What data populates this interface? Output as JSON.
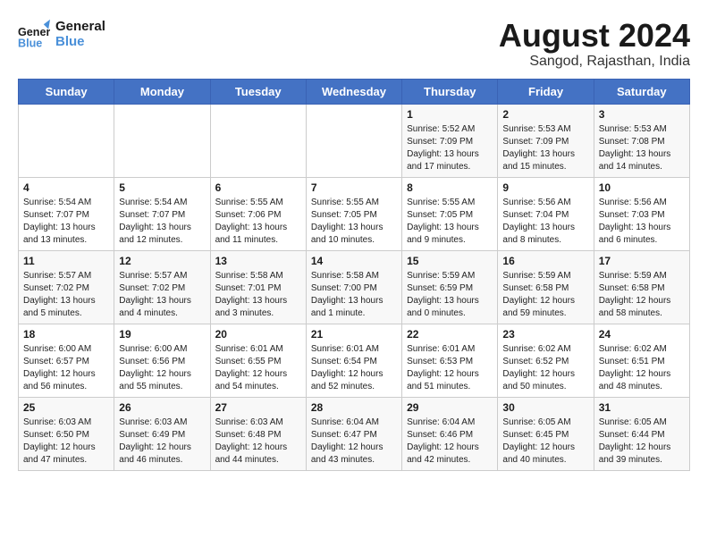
{
  "header": {
    "logo_line1": "General",
    "logo_line2": "Blue",
    "title": "August 2024",
    "subtitle": "Sangod, Rajasthan, India"
  },
  "calendar": {
    "weekdays": [
      "Sunday",
      "Monday",
      "Tuesday",
      "Wednesday",
      "Thursday",
      "Friday",
      "Saturday"
    ],
    "weeks": [
      [
        {
          "date": "",
          "info": ""
        },
        {
          "date": "",
          "info": ""
        },
        {
          "date": "",
          "info": ""
        },
        {
          "date": "",
          "info": ""
        },
        {
          "date": "1",
          "info": "Sunrise: 5:52 AM\nSunset: 7:09 PM\nDaylight: 13 hours and 17 minutes."
        },
        {
          "date": "2",
          "info": "Sunrise: 5:53 AM\nSunset: 7:09 PM\nDaylight: 13 hours and 15 minutes."
        },
        {
          "date": "3",
          "info": "Sunrise: 5:53 AM\nSunset: 7:08 PM\nDaylight: 13 hours and 14 minutes."
        }
      ],
      [
        {
          "date": "4",
          "info": "Sunrise: 5:54 AM\nSunset: 7:07 PM\nDaylight: 13 hours and 13 minutes."
        },
        {
          "date": "5",
          "info": "Sunrise: 5:54 AM\nSunset: 7:07 PM\nDaylight: 13 hours and 12 minutes."
        },
        {
          "date": "6",
          "info": "Sunrise: 5:55 AM\nSunset: 7:06 PM\nDaylight: 13 hours and 11 minutes."
        },
        {
          "date": "7",
          "info": "Sunrise: 5:55 AM\nSunset: 7:05 PM\nDaylight: 13 hours and 10 minutes."
        },
        {
          "date": "8",
          "info": "Sunrise: 5:55 AM\nSunset: 7:05 PM\nDaylight: 13 hours and 9 minutes."
        },
        {
          "date": "9",
          "info": "Sunrise: 5:56 AM\nSunset: 7:04 PM\nDaylight: 13 hours and 8 minutes."
        },
        {
          "date": "10",
          "info": "Sunrise: 5:56 AM\nSunset: 7:03 PM\nDaylight: 13 hours and 6 minutes."
        }
      ],
      [
        {
          "date": "11",
          "info": "Sunrise: 5:57 AM\nSunset: 7:02 PM\nDaylight: 13 hours and 5 minutes."
        },
        {
          "date": "12",
          "info": "Sunrise: 5:57 AM\nSunset: 7:02 PM\nDaylight: 13 hours and 4 minutes."
        },
        {
          "date": "13",
          "info": "Sunrise: 5:58 AM\nSunset: 7:01 PM\nDaylight: 13 hours and 3 minutes."
        },
        {
          "date": "14",
          "info": "Sunrise: 5:58 AM\nSunset: 7:00 PM\nDaylight: 13 hours and 1 minute."
        },
        {
          "date": "15",
          "info": "Sunrise: 5:59 AM\nSunset: 6:59 PM\nDaylight: 13 hours and 0 minutes."
        },
        {
          "date": "16",
          "info": "Sunrise: 5:59 AM\nSunset: 6:58 PM\nDaylight: 12 hours and 59 minutes."
        },
        {
          "date": "17",
          "info": "Sunrise: 5:59 AM\nSunset: 6:58 PM\nDaylight: 12 hours and 58 minutes."
        }
      ],
      [
        {
          "date": "18",
          "info": "Sunrise: 6:00 AM\nSunset: 6:57 PM\nDaylight: 12 hours and 56 minutes."
        },
        {
          "date": "19",
          "info": "Sunrise: 6:00 AM\nSunset: 6:56 PM\nDaylight: 12 hours and 55 minutes."
        },
        {
          "date": "20",
          "info": "Sunrise: 6:01 AM\nSunset: 6:55 PM\nDaylight: 12 hours and 54 minutes."
        },
        {
          "date": "21",
          "info": "Sunrise: 6:01 AM\nSunset: 6:54 PM\nDaylight: 12 hours and 52 minutes."
        },
        {
          "date": "22",
          "info": "Sunrise: 6:01 AM\nSunset: 6:53 PM\nDaylight: 12 hours and 51 minutes."
        },
        {
          "date": "23",
          "info": "Sunrise: 6:02 AM\nSunset: 6:52 PM\nDaylight: 12 hours and 50 minutes."
        },
        {
          "date": "24",
          "info": "Sunrise: 6:02 AM\nSunset: 6:51 PM\nDaylight: 12 hours and 48 minutes."
        }
      ],
      [
        {
          "date": "25",
          "info": "Sunrise: 6:03 AM\nSunset: 6:50 PM\nDaylight: 12 hours and 47 minutes."
        },
        {
          "date": "26",
          "info": "Sunrise: 6:03 AM\nSunset: 6:49 PM\nDaylight: 12 hours and 46 minutes."
        },
        {
          "date": "27",
          "info": "Sunrise: 6:03 AM\nSunset: 6:48 PM\nDaylight: 12 hours and 44 minutes."
        },
        {
          "date": "28",
          "info": "Sunrise: 6:04 AM\nSunset: 6:47 PM\nDaylight: 12 hours and 43 minutes."
        },
        {
          "date": "29",
          "info": "Sunrise: 6:04 AM\nSunset: 6:46 PM\nDaylight: 12 hours and 42 minutes."
        },
        {
          "date": "30",
          "info": "Sunrise: 6:05 AM\nSunset: 6:45 PM\nDaylight: 12 hours and 40 minutes."
        },
        {
          "date": "31",
          "info": "Sunrise: 6:05 AM\nSunset: 6:44 PM\nDaylight: 12 hours and 39 minutes."
        }
      ]
    ]
  }
}
